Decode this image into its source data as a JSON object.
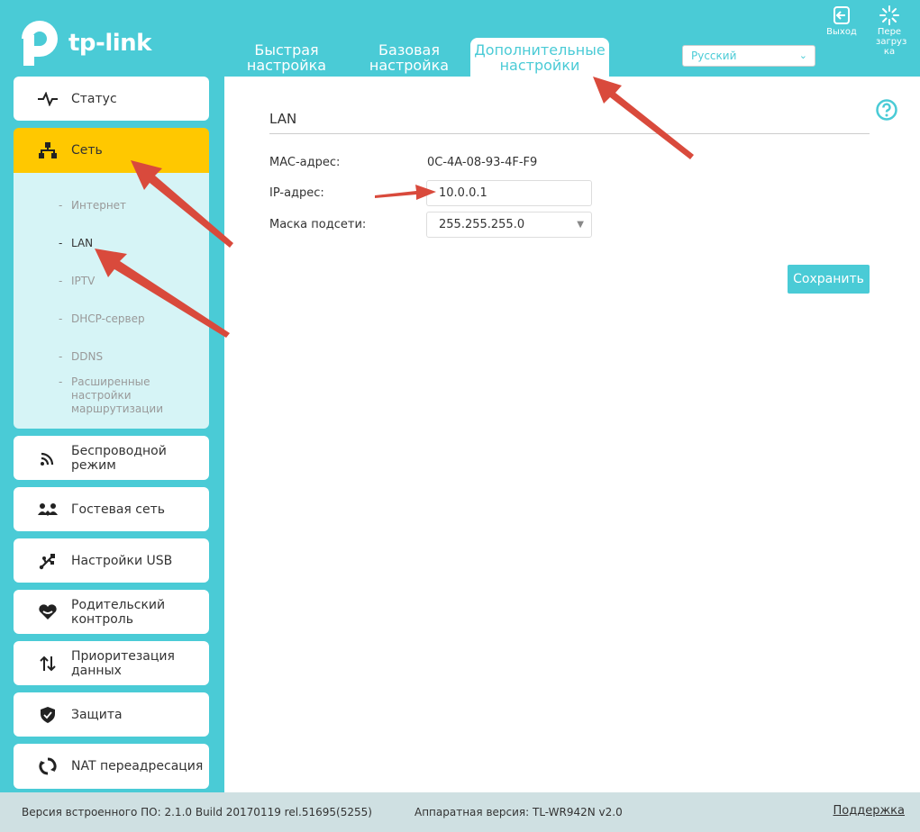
{
  "brand": {
    "name": "tp-link"
  },
  "nav": {
    "tabs": [
      {
        "label": "Быстрая настройка"
      },
      {
        "label": "Базовая настройка"
      },
      {
        "label": "Дополнительные настройки"
      }
    ],
    "active_tab": 2
  },
  "language": {
    "selected": "Русский"
  },
  "top_buttons": {
    "logout": "Выход",
    "reboot": "Пере загруз ка"
  },
  "sidebar": {
    "items": [
      {
        "label": "Статус",
        "icon": "pulse-icon"
      },
      {
        "label": "Сеть",
        "icon": "network-icon"
      },
      {
        "label": "Беспроводной режим",
        "icon": "wifi-icon"
      },
      {
        "label": "Гостевая сеть",
        "icon": "guest-network-icon"
      },
      {
        "label": "Настройки USB",
        "icon": "usb-icon"
      },
      {
        "label": "Родительский контроль",
        "icon": "heart-icon"
      },
      {
        "label": "Приоритезация данных",
        "icon": "priority-arrows-icon"
      },
      {
        "label": "Защита",
        "icon": "shield-icon"
      },
      {
        "label": "NAT переадресация",
        "icon": "nat-icon"
      }
    ],
    "active_item": 1,
    "submenu": [
      {
        "label": "Интернет"
      },
      {
        "label": "LAN"
      },
      {
        "label": "IPTV"
      },
      {
        "label": "DHCP-сервер"
      },
      {
        "label": "DDNS"
      },
      {
        "label": "Расширенные настройки маршрутизации"
      }
    ],
    "active_submenu": 1,
    "dash": "-"
  },
  "lan": {
    "title": "LAN",
    "mac_label": "MAC-адрес:",
    "mac_value": "0C-4A-08-93-4F-F9",
    "ip_label": "IP-адрес:",
    "ip_value": "10.0.0.1",
    "mask_label": "Маска подсети:",
    "mask_value": "255.255.255.0",
    "save_label": "Сохранить"
  },
  "footer": {
    "firmware": "Версия встроенного ПО: 2.1.0 Build 20170119 rel.51695(5255)",
    "hardware": "Аппаратная версия: TL-WR942N v2.0",
    "support": "Поддержка"
  },
  "colors": {
    "accent": "#4acbd6",
    "active_menu": "#ffc800",
    "submenu_bg": "#d6f4f6",
    "annotation_arrow": "#d94a3c"
  }
}
